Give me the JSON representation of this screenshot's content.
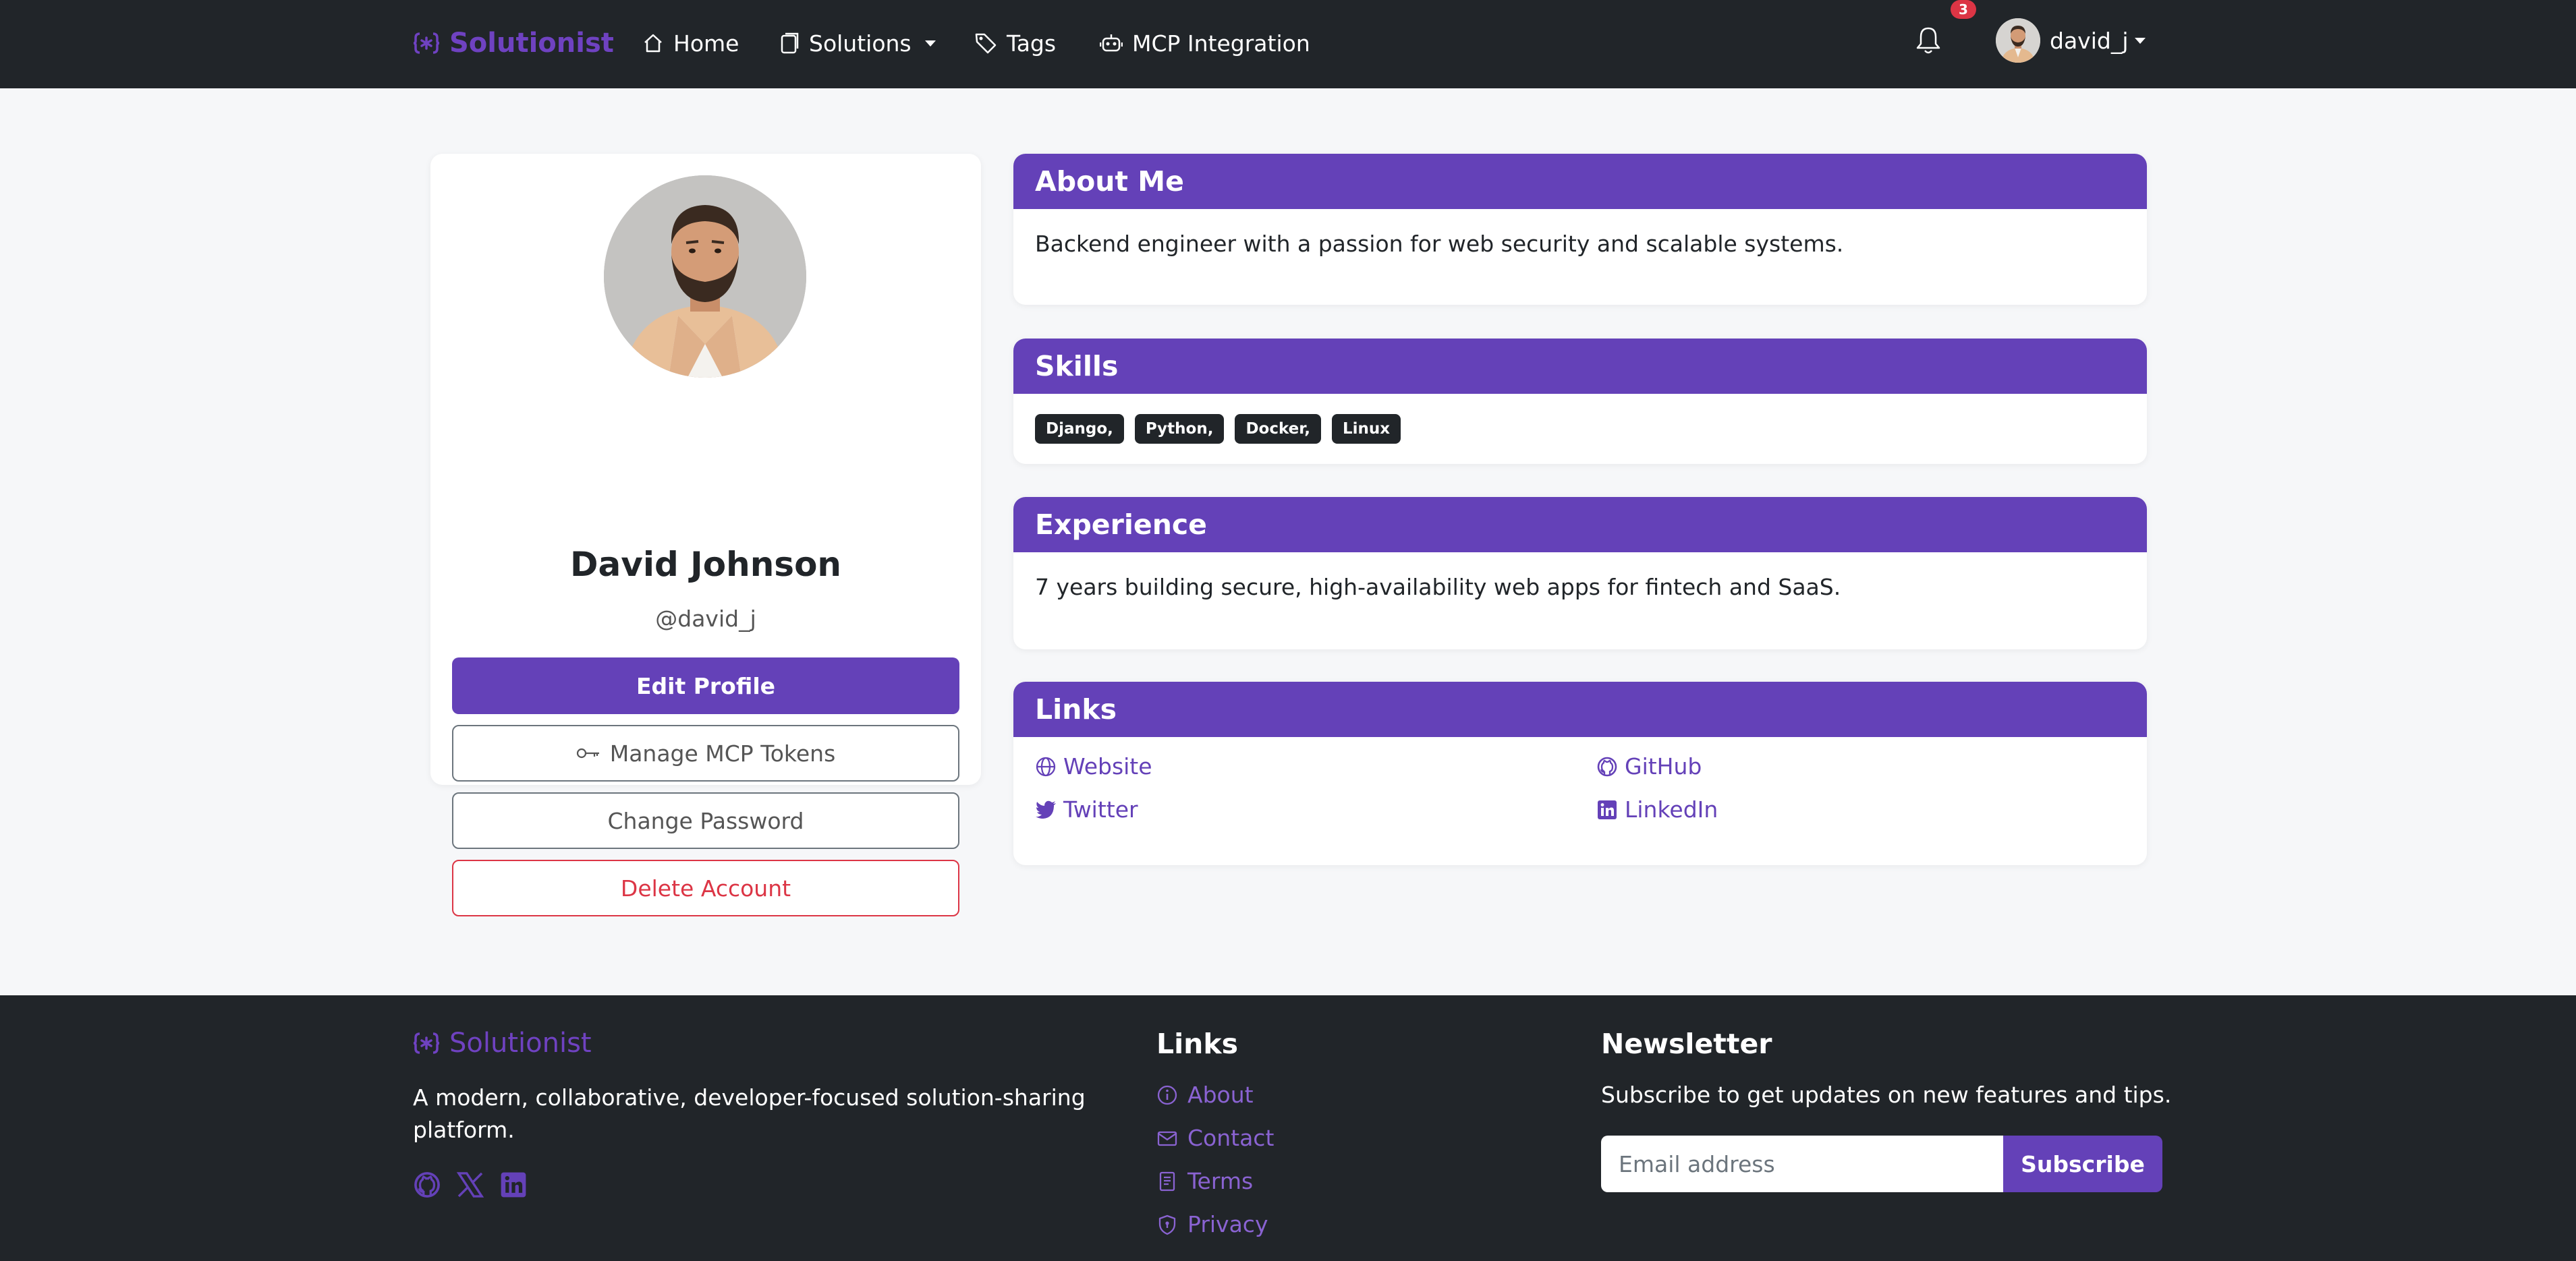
{
  "navbar": {
    "brand": "Solutionist",
    "items": [
      {
        "label": "Home",
        "icon": "home-icon"
      },
      {
        "label": "Solutions",
        "icon": "file-icon"
      },
      {
        "label": "Tags",
        "icon": "tag-icon"
      },
      {
        "label": "MCP Integration",
        "icon": "robot-icon"
      }
    ],
    "notification_count": "3",
    "username": "david_j"
  },
  "profile": {
    "name": "David Johnson",
    "handle": "@david_j",
    "buttons": {
      "edit": "Edit Profile",
      "tokens": "Manage MCP Tokens",
      "password": "Change Password",
      "delete": "Delete Account"
    }
  },
  "about": {
    "title": "About Me",
    "text": "Backend engineer with a passion for web security and scalable systems."
  },
  "skills": {
    "title": "Skills",
    "tags": [
      "Django,",
      "Python,",
      "Docker,",
      "Linux"
    ]
  },
  "experience": {
    "title": "Experience",
    "text": "7 years building secure, high-availability web apps for fintech and SaaS."
  },
  "links": {
    "title": "Links",
    "items": [
      {
        "label": "Website",
        "icon": "globe-icon"
      },
      {
        "label": "GitHub",
        "icon": "github-icon"
      },
      {
        "label": "Twitter",
        "icon": "twitter-icon"
      },
      {
        "label": "LinkedIn",
        "icon": "linkedin-icon"
      }
    ]
  },
  "footer": {
    "brand": "Solutionist",
    "description": "A modern, collaborative, developer-focused solution-sharing platform.",
    "links_title": "Links",
    "links": [
      {
        "label": "About",
        "icon": "info-icon"
      },
      {
        "label": "Contact",
        "icon": "envelope-icon"
      },
      {
        "label": "Terms",
        "icon": "document-icon"
      },
      {
        "label": "Privacy",
        "icon": "shield-icon"
      }
    ],
    "newsletter_title": "Newsletter",
    "newsletter_text": "Subscribe to get updates on new features and tips.",
    "email_placeholder": "Email address",
    "subscribe_label": "Subscribe"
  },
  "colors": {
    "navbar_bg": "#212529",
    "accent": "#6441b8",
    "brand": "#6f42c1",
    "danger": "#dc3545",
    "page_bg": "#f6f7f9"
  }
}
